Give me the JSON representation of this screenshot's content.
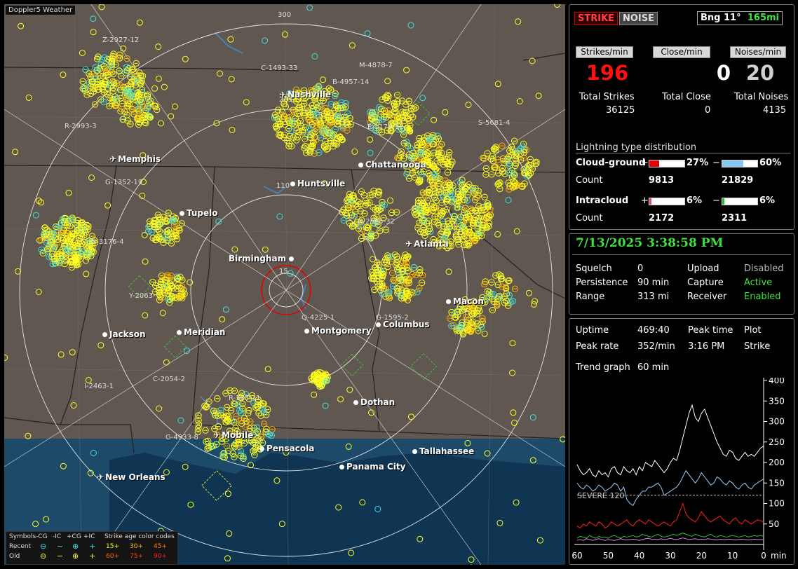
{
  "map": {
    "title": "Doppler5 Weather",
    "rings": [
      "300",
      "110",
      "15"
    ],
    "cities": [
      {
        "name": "Nashville",
        "airport": true
      },
      {
        "name": "Memphis",
        "airport": true
      },
      {
        "name": "Chattanooga",
        "airport": false
      },
      {
        "name": "Huntsville",
        "airport": false
      },
      {
        "name": "Tupelo",
        "airport": false
      },
      {
        "name": "Atlanta",
        "airport": true
      },
      {
        "name": "Birmingham",
        "airport": false
      },
      {
        "name": "Macon",
        "airport": false
      },
      {
        "name": "Jackson",
        "airport": false
      },
      {
        "name": "Meridian",
        "airport": false
      },
      {
        "name": "Montgomery",
        "airport": false
      },
      {
        "name": "Columbus",
        "airport": false
      },
      {
        "name": "Dothan",
        "airport": false
      },
      {
        "name": "Mobile",
        "airport": true
      },
      {
        "name": "Pensacola",
        "airport": false
      },
      {
        "name": "Tallahassee",
        "airport": false
      },
      {
        "name": "Panama City",
        "airport": false
      },
      {
        "name": "New Orleans",
        "airport": true
      }
    ],
    "cells": [
      "Z-2927-12",
      "C-1493-33",
      "M-4878-7",
      "B-4957-14",
      "205-",
      "R-2993-3",
      "E-1176-12",
      "S-5681-4",
      "G-1352-19",
      "N-3176-4",
      "N-2585-32",
      "Y-2063-",
      "Q-4225-1",
      "G-1595-2",
      "C-2054-2",
      "I-2463-1",
      "R-385-11",
      "G-4933-8"
    ],
    "legend": {
      "symbols_label": "Symbols",
      "types": [
        "-CG",
        "-IC",
        "+CG",
        "+IC"
      ],
      "age_label": "Strike age color codes",
      "recent_label": "Recent",
      "old_label": "Old",
      "recent_ages": [
        "15+",
        "30+",
        "45+"
      ],
      "old_ages": [
        "60+",
        "75+",
        "90+"
      ],
      "age_colors": [
        "#ffff00",
        "#ffc000",
        "#ff8000",
        "#ff6a00",
        "#ff4000",
        "#ff2020"
      ]
    }
  },
  "panel": {
    "strike_label": "STRIKE",
    "noise_label": "NOISE",
    "bearing": "Bng 11°",
    "range_value": "165mi",
    "strikes_per_min_label": "Strikes/min",
    "close_per_min_label": "Close/min",
    "noises_per_min_label": "Noises/min",
    "strikes_per_min": "196",
    "close_per_min": "0",
    "noises_per_min": "20",
    "total_strikes_label": "Total Strikes",
    "total_close_label": "Total Close",
    "total_noises_label": "Total Noises",
    "total_strikes": "36125",
    "total_close": "0",
    "total_noises": "4135",
    "distribution_title": "Lightning type distribution",
    "cloud_ground_label": "Cloud-ground",
    "intracloud_label": "Intracloud",
    "count_label": "Count",
    "plus_sign": "+",
    "minus_sign": "−",
    "cg_plus_pct": "27%",
    "cg_minus_pct": "60%",
    "cg_plus_count": "9813",
    "cg_minus_count": "21829",
    "ic_plus_pct": "6%",
    "ic_minus_pct": "6%",
    "ic_plus_count": "2172",
    "ic_minus_count": "2311",
    "cg_plus_fraction": 0.27,
    "cg_minus_fraction": 0.6,
    "ic_plus_fraction": 0.06,
    "ic_minus_fraction": 0.06
  },
  "status": {
    "datetime": "7/13/2025 3:38:58 PM",
    "squelch_label": "Squelch",
    "squelch": "0",
    "persistence_label": "Persistence",
    "persistence": "90 min",
    "range_label": "Range",
    "range": "313 mi",
    "upload_label": "Upload",
    "upload": "Disabled",
    "capture_label": "Capture",
    "capture": "Active",
    "receiver_label": "Receiver",
    "receiver": "Enabled"
  },
  "stats": {
    "uptime_label": "Uptime",
    "uptime": "469:40",
    "peak_time_label": "Peak time",
    "peak_time": "3:16 PM",
    "plot_label": "Plot",
    "plot": "Strike",
    "peak_rate_label": "Peak rate",
    "peak_rate": "352/min",
    "trend_label": "Trend graph",
    "trend": "60 min",
    "severe_label": "SEVERE 120"
  },
  "chart_data": {
    "type": "line",
    "xlabel": "min",
    "x_ticks": [
      "60",
      "50",
      "40",
      "30",
      "20",
      "10",
      "0"
    ],
    "y_ticks": [
      "400",
      "350",
      "300",
      "250",
      "200",
      "150",
      "100",
      "50"
    ],
    "ylim": [
      0,
      400
    ],
    "xlim": [
      60,
      0
    ],
    "threshold": 120,
    "series": [
      {
        "color": "#ffffff",
        "values": [
          195,
          180,
          170,
          175,
          185,
          170,
          165,
          180,
          170,
          175,
          165,
          185,
          190,
          175,
          170,
          190,
          180,
          175,
          185,
          170,
          190,
          180,
          200,
          195,
          190,
          205,
          195,
          185,
          175,
          185,
          200,
          210,
          205,
          230,
          260,
          290,
          320,
          340,
          310,
          300,
          320,
          330,
          310,
          290,
          270,
          250,
          235,
          220,
          215,
          230,
          225,
          210,
          205,
          215,
          225,
          215,
          220,
          215,
          225,
          235,
          240
        ]
      },
      {
        "color": "#9ccbf5",
        "values": [
          150,
          140,
          135,
          145,
          140,
          130,
          135,
          145,
          140,
          130,
          135,
          140,
          150,
          145,
          130,
          140,
          110,
          100,
          95,
          110,
          120,
          130,
          130,
          140,
          140,
          145,
          150,
          140,
          120,
          125,
          130,
          135,
          140,
          150,
          165,
          180,
          170,
          160,
          150,
          160,
          175,
          165,
          155,
          145,
          150,
          165,
          160,
          150,
          145,
          155,
          150,
          140,
          135,
          145,
          150,
          140,
          135,
          145,
          150,
          155,
          160
        ]
      },
      {
        "color": "#ff2020",
        "values": [
          45,
          40,
          50,
          45,
          55,
          50,
          45,
          55,
          50,
          40,
          45,
          55,
          50,
          45,
          50,
          55,
          60,
          50,
          45,
          55,
          60,
          55,
          50,
          60,
          55,
          50,
          45,
          50,
          55,
          50,
          45,
          55,
          60,
          80,
          100,
          75,
          65,
          60,
          55,
          65,
          80,
          70,
          60,
          55,
          60,
          65,
          70,
          60,
          55,
          50,
          60,
          65,
          55,
          50,
          60,
          55,
          50,
          55,
          60,
          58,
          55
        ]
      },
      {
        "color": "#30c030",
        "values": [
          15,
          20,
          18,
          15,
          22,
          18,
          15,
          20,
          17,
          18,
          15,
          20,
          22,
          18,
          15,
          20,
          18,
          20,
          22,
          18,
          20,
          25,
          22,
          20,
          18,
          22,
          25,
          20,
          18,
          20,
          22,
          25,
          22,
          25,
          28,
          25,
          22,
          20,
          25,
          22,
          20,
          18,
          22,
          25,
          20,
          18,
          22,
          20,
          18,
          20,
          22,
          20,
          18,
          20,
          22,
          18,
          20,
          22,
          20,
          22,
          20
        ]
      },
      {
        "color": "#e080e0",
        "values": [
          10,
          12,
          10,
          14,
          12,
          10,
          12,
          14,
          12,
          10,
          12,
          11,
          10,
          12,
          14,
          12,
          11,
          12,
          13,
          12,
          10,
          12,
          14,
          15,
          12,
          13,
          12,
          14,
          12,
          13,
          15,
          13,
          12,
          14,
          16,
          14,
          12,
          13,
          14,
          12,
          13,
          12,
          14,
          13,
          12,
          11,
          13,
          12,
          12,
          13,
          12,
          11,
          12,
          13,
          12,
          11,
          12,
          13,
          12,
          12,
          12
        ]
      }
    ]
  }
}
